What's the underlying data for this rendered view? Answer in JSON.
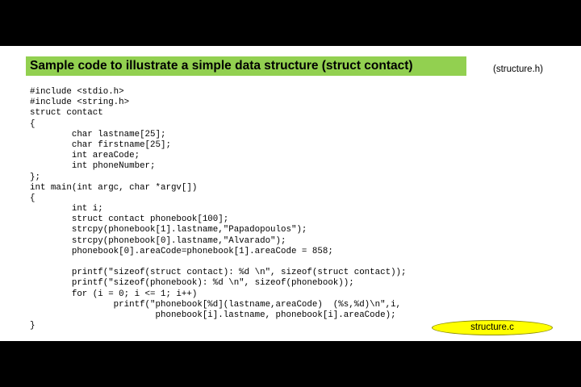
{
  "slide": {
    "title": "Sample code to illustrate a simple data structure (struct contact)",
    "header_file_label": "(structure.h)",
    "source_file_label": "structure.c",
    "colors": {
      "title_background": "#92d050",
      "badge_background": "#ffff00",
      "frame": "#000000",
      "slide_background": "#ffffff"
    }
  },
  "code": {
    "lines": [
      "#include <stdio.h>",
      "#include <string.h>",
      "struct contact",
      "{",
      "        char lastname[25];",
      "        char firstname[25];",
      "        int areaCode;",
      "        int phoneNumber;",
      "};",
      "int main(int argc, char *argv[])",
      "{",
      "        int i;",
      "        struct contact phonebook[100];",
      "        strcpy(phonebook[1].lastname,\"Papadopoulos\");",
      "        strcpy(phonebook[0].lastname,\"Alvarado\");",
      "        phonebook[0].areaCode=phonebook[1].areaCode = 858;",
      "",
      "        printf(\"sizeof(struct contact): %d \\n\", sizeof(struct contact));",
      "        printf(\"sizeof(phonebook): %d \\n\", sizeof(phonebook));",
      "        for (i = 0; i <= 1; i++)",
      "                printf(\"phonebook[%d](lastname,areaCode)  (%s,%d)\\n\",i,",
      "                        phonebook[i].lastname, phonebook[i].areaCode);",
      "}"
    ]
  }
}
